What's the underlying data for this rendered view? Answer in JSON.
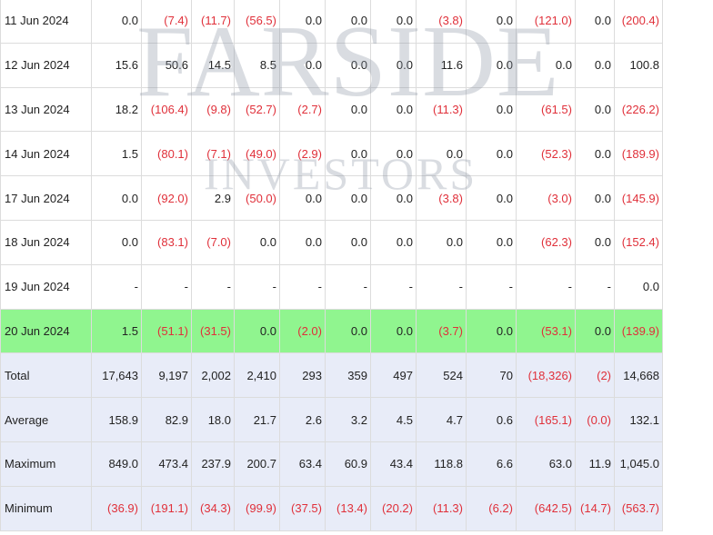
{
  "columns_count": 13,
  "watermark": {
    "main": "FARSIDE",
    "sub": "INVESTORS"
  },
  "rows": [
    {
      "label": "11 Jun 2024",
      "values": [
        "0.0",
        "(7.4)",
        "(11.7)",
        "(56.5)",
        "0.0",
        "0.0",
        "0.0",
        "(3.8)",
        "0.0",
        "(121.0)",
        "0.0",
        "(200.4)"
      ]
    },
    {
      "label": "12 Jun 2024",
      "values": [
        "15.6",
        "50.6",
        "14.5",
        "8.5",
        "0.0",
        "0.0",
        "0.0",
        "11.6",
        "0.0",
        "0.0",
        "0.0",
        "100.8"
      ]
    },
    {
      "label": "13 Jun 2024",
      "values": [
        "18.2",
        "(106.4)",
        "(9.8)",
        "(52.7)",
        "(2.7)",
        "0.0",
        "0.0",
        "(11.3)",
        "0.0",
        "(61.5)",
        "0.0",
        "(226.2)"
      ]
    },
    {
      "label": "14 Jun 2024",
      "values": [
        "1.5",
        "(80.1)",
        "(7.1)",
        "(49.0)",
        "(2.9)",
        "0.0",
        "0.0",
        "0.0",
        "0.0",
        "(52.3)",
        "0.0",
        "(189.9)"
      ]
    },
    {
      "label": "17 Jun 2024",
      "values": [
        "0.0",
        "(92.0)",
        "2.9",
        "(50.0)",
        "0.0",
        "0.0",
        "0.0",
        "(3.8)",
        "0.0",
        "(3.0)",
        "0.0",
        "(145.9)"
      ]
    },
    {
      "label": "18 Jun 2024",
      "values": [
        "0.0",
        "(83.1)",
        "(7.0)",
        "0.0",
        "0.0",
        "0.0",
        "0.0",
        "0.0",
        "0.0",
        "(62.3)",
        "0.0",
        "(152.4)"
      ]
    },
    {
      "label": "19 Jun 2024",
      "values": [
        "-",
        "-",
        "-",
        "-",
        "-",
        "-",
        "-",
        "-",
        "-",
        "-",
        "-",
        "0.0"
      ]
    },
    {
      "label": "20 Jun 2024",
      "highlight": true,
      "values": [
        "1.5",
        "(51.1)",
        "(31.5)",
        "0.0",
        "(2.0)",
        "0.0",
        "0.0",
        "(3.7)",
        "0.0",
        "(53.1)",
        "0.0",
        "(139.9)"
      ]
    }
  ],
  "summary_rows": [
    {
      "label": "Total",
      "values": [
        "17,643",
        "9,197",
        "2,002",
        "2,410",
        "293",
        "359",
        "497",
        "524",
        "70",
        "(18,326)",
        "(2)",
        "14,668"
      ]
    },
    {
      "label": "Average",
      "values": [
        "158.9",
        "82.9",
        "18.0",
        "21.7",
        "2.6",
        "3.2",
        "4.5",
        "4.7",
        "0.6",
        "(165.1)",
        "(0.0)",
        "132.1"
      ]
    },
    {
      "label": "Maximum",
      "values": [
        "849.0",
        "473.4",
        "237.9",
        "200.7",
        "63.4",
        "60.9",
        "43.4",
        "118.8",
        "6.6",
        "63.0",
        "11.9",
        "1,045.0"
      ]
    },
    {
      "label": "Minimum",
      "values": [
        "(36.9)",
        "(191.1)",
        "(34.3)",
        "(99.9)",
        "(37.5)",
        "(13.4)",
        "(20.2)",
        "(11.3)",
        "(6.2)",
        "(642.5)",
        "(14.7)",
        "(563.7)"
      ]
    }
  ],
  "colors": {
    "negative": "#e0303a",
    "highlight_row": "#90f58f",
    "summary_bg": "#e8ecf8",
    "grid": "#dcdcdc"
  }
}
